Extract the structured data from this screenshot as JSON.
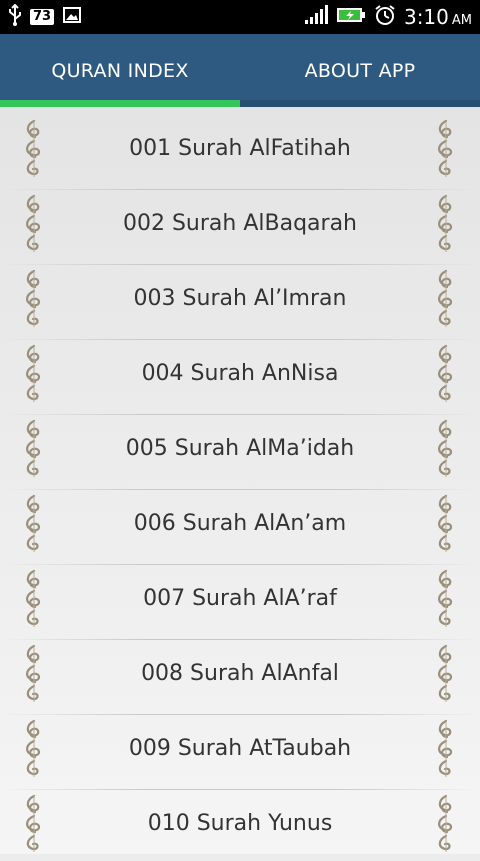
{
  "status_bar": {
    "left_icons": [
      "usb-icon",
      "notification-73-icon",
      "image-icon"
    ],
    "notification_count": "73",
    "right_icons": [
      "signal-icon",
      "battery-charging-icon",
      "alarm-clock-icon"
    ],
    "time": "3:10",
    "ampm": "AM"
  },
  "tabs": [
    {
      "label": "QURAN INDEX",
      "active": true
    },
    {
      "label": "ABOUT APP",
      "active": false
    }
  ],
  "colors": {
    "tab_bar": "#2e5a82",
    "active_indicator": "#35c65a",
    "list_text": "#333333"
  },
  "surahs": [
    {
      "label": "001 Surah AlFatihah"
    },
    {
      "label": "002 Surah AlBaqarah"
    },
    {
      "label": "003 Surah Al’Imran"
    },
    {
      "label": "004 Surah AnNisa"
    },
    {
      "label": "005 Surah AlMa’idah"
    },
    {
      "label": "006 Surah AlAn’am"
    },
    {
      "label": "007 Surah AlA’raf"
    },
    {
      "label": "008 Surah AlAnfal"
    },
    {
      "label": "009 Surah AtTaubah"
    },
    {
      "label": "010 Surah Yunus"
    }
  ],
  "item_ornament_icon": "calligraphy-ornament-icon"
}
